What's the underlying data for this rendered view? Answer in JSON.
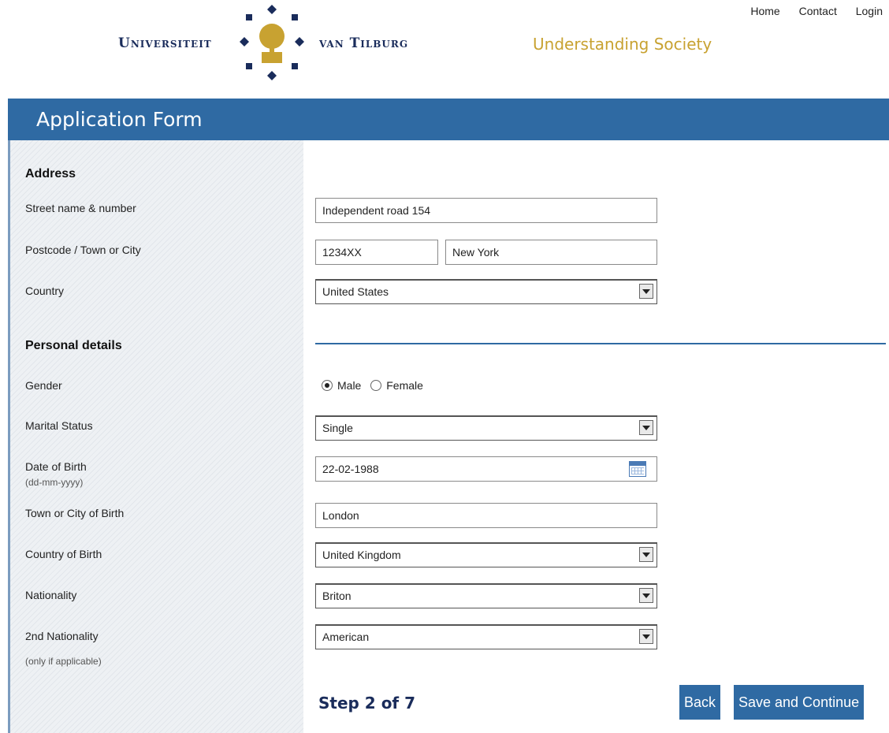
{
  "top_nav": {
    "home": "Home",
    "contact": "Contact",
    "login": "Login"
  },
  "logo": {
    "left_text": "Universiteit",
    "right_text": "van Tilburg"
  },
  "tagline": "Understanding Society",
  "banner": {
    "title": "Application Form"
  },
  "address": {
    "section_title": "Address",
    "street_label": "Street name & number",
    "street_value": "Independent road 154",
    "postcode_label": "Postcode / Town or City",
    "postcode_value": "1234XX",
    "city_value": "New York",
    "country_label": "Country",
    "country_value": "United States"
  },
  "personal": {
    "section_title": "Personal details",
    "gender_label": "Gender",
    "gender_options": [
      "Male",
      "Female"
    ],
    "gender_selected": "Male",
    "marital_label": "Marital Status",
    "marital_value": "Single",
    "dob_label": "Date of Birth",
    "dob_hint": "(dd-mm-yyyy)",
    "dob_value": "22-02-1988",
    "town_birth_label": "Town or City of Birth",
    "town_birth_value": "London",
    "country_birth_label": "Country of Birth",
    "country_birth_value": "United Kingdom",
    "nationality_label": "Nationality",
    "nationality_value": "Briton",
    "nationality2_label": "2nd Nationality",
    "nationality2_hint": "(only if applicable)",
    "nationality2_value": "American"
  },
  "footer": {
    "step": "Step 2 of 7",
    "back": "Back",
    "save": "Save and Continue"
  },
  "colors": {
    "banner": "#2f6aa3",
    "tagline": "#c8a231",
    "logo": "#1a2c5b"
  }
}
